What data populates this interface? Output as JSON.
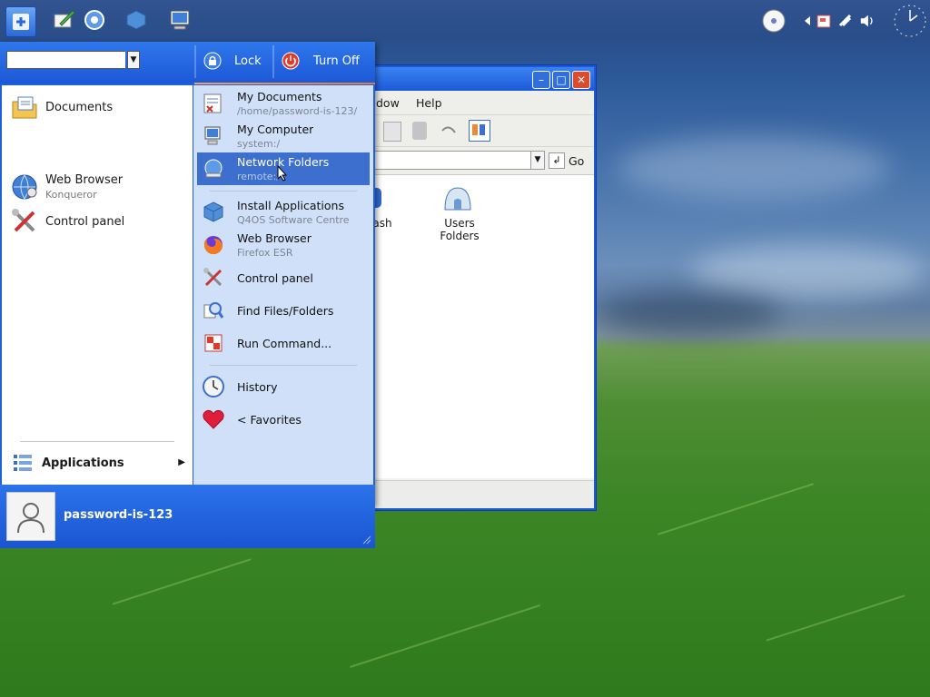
{
  "colors": {
    "menu_blue": "#1f5fd8",
    "menu_highlight": "#3d6fcf",
    "right_panel": "#cfe0f8",
    "orange_accent": "#e07a3a"
  },
  "taskbar": {
    "start_icon": "start-menu-icon",
    "quicklaunch": [
      "text-editor-icon",
      "web-browser-icon",
      "software-package-icon",
      "my-computer-icon"
    ],
    "tray": [
      "cd-disc-icon",
      "tray-arrow-icon",
      "notes-icon",
      "network-icon",
      "volume-icon",
      "clock-icon"
    ]
  },
  "start_menu": {
    "search": {
      "value": ""
    },
    "lock_label": "Lock",
    "turnoff_label": "Turn Off",
    "left_items": [
      {
        "label": "Documents",
        "sub": "",
        "icon": "documents-folder-icon"
      },
      {
        "label": "Web Browser",
        "sub": "Konqueror",
        "icon": "konqueror-globe-icon"
      },
      {
        "label": "Control panel",
        "sub": "",
        "icon": "control-panel-tools-icon"
      }
    ],
    "applications_label": "Applications",
    "right_items": [
      {
        "label": "My Documents",
        "sub": "/home/password-is-123/",
        "icon": "my-documents-icon"
      },
      {
        "label": "My Computer",
        "sub": "system:/",
        "icon": "my-computer-icon"
      },
      {
        "label": "Network Folders",
        "sub": "remote:/",
        "icon": "network-folders-icon"
      },
      {
        "label": "Install Applications",
        "sub": "Q4OS Software Centre",
        "icon": "software-centre-icon"
      },
      {
        "label": "Web Browser",
        "sub": "Firefox ESR",
        "icon": "firefox-icon"
      },
      {
        "label": "Control panel",
        "sub": "",
        "icon": "control-panel-tools-icon"
      },
      {
        "label": "Find Files/Folders",
        "sub": "",
        "icon": "find-files-icon"
      },
      {
        "label": "Run Command...",
        "sub": "",
        "icon": "run-command-icon"
      },
      {
        "label": "History",
        "sub": "",
        "icon": "history-clock-icon"
      },
      {
        "label": "< Favorites",
        "sub": "",
        "icon": "favorites-heart-icon"
      }
    ],
    "username": "password-is-123"
  },
  "file_manager": {
    "menu_items": [
      "dow",
      "Help"
    ],
    "go_label": "Go",
    "icons": [
      {
        "label": "ash"
      },
      {
        "label": "Users\nFolders"
      }
    ]
  }
}
